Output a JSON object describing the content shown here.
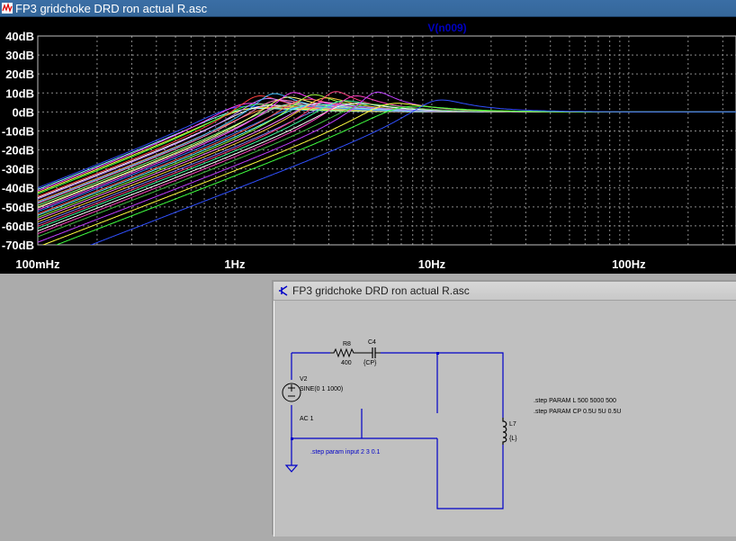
{
  "plot_window": {
    "title": "FP3 gridchoke DRD ron actual R.asc",
    "trace_label": "V(n009)",
    "colors": {
      "background": "#000000",
      "grid": "#8a8a8a",
      "axis_text": "#ffffff",
      "trace_label": "#0000c0"
    }
  },
  "chart_data": {
    "type": "line",
    "title": "",
    "xscale": "log",
    "xlim_hz": [
      0.1,
      350
    ],
    "ylim_db": [
      -70,
      40
    ],
    "grid": true,
    "x_tick_labels": [
      "100mHz",
      "1Hz",
      "10Hz",
      "100Hz"
    ],
    "y_tick_labels": [
      "40dB",
      "30dB",
      "20dB",
      "10dB",
      "0dB",
      "-10dB",
      "-20dB",
      "-30dB",
      "-40dB",
      "-50dB",
      "-60dB",
      "-70dB"
    ],
    "y_ticks_db": [
      40,
      30,
      20,
      10,
      0,
      -10,
      -20,
      -30,
      -40,
      -50,
      -60,
      -70
    ],
    "x_ticks_hz": [
      0.1,
      1,
      10,
      100
    ],
    "series_description_values": {
      "resonance_hz_range": [
        1,
        10.5
      ],
      "peak_db_range": [
        12,
        32
      ],
      "lowfreq_db_at_100mHz_range": [
        -66,
        -40
      ]
    },
    "series": [
      {
        "color": "#3050ff",
        "f0": 1.0,
        "q": 1.3
      },
      {
        "color": "#80ffff",
        "f0": 1.05,
        "q": 1.1
      },
      {
        "color": "#ff40ff",
        "f0": 1.1,
        "q": 1.6
      },
      {
        "color": "#ffff40",
        "f0": 1.15,
        "q": 1.2
      },
      {
        "color": "#40ff40",
        "f0": 1.2,
        "q": 1.5
      },
      {
        "color": "#ff4040",
        "f0": 1.3,
        "q": 2.6
      },
      {
        "color": "#ffffff",
        "f0": 1.35,
        "q": 1.4
      },
      {
        "color": "#c080ff",
        "f0": 1.4,
        "q": 2.2
      },
      {
        "color": "#ff8040",
        "f0": 1.5,
        "q": 1.3
      },
      {
        "color": "#40c0ff",
        "f0": 1.55,
        "q": 3.0
      },
      {
        "color": "#ff80c0",
        "f0": 1.6,
        "q": 2.0
      },
      {
        "color": "#80ff80",
        "f0": 1.7,
        "q": 1.4
      },
      {
        "color": "#ffff80",
        "f0": 1.8,
        "q": 2.4
      },
      {
        "color": "#c0c0c0",
        "f0": 1.85,
        "q": 1.6
      },
      {
        "color": "#ff40ff",
        "f0": 1.95,
        "q": 3.2
      },
      {
        "color": "#4080ff",
        "f0": 2.05,
        "q": 1.3
      },
      {
        "color": "#ff6060",
        "f0": 2.2,
        "q": 2.1
      },
      {
        "color": "#60ffff",
        "f0": 2.3,
        "q": 1.5
      },
      {
        "color": "#a0ff40",
        "f0": 2.45,
        "q": 2.8
      },
      {
        "color": "#ff80ff",
        "f0": 2.6,
        "q": 1.7
      },
      {
        "color": "#ffd040",
        "f0": 2.8,
        "q": 2.3
      },
      {
        "color": "#8080ff",
        "f0": 3.0,
        "q": 1.4
      },
      {
        "color": "#ff4080",
        "f0": 3.2,
        "q": 3.4
      },
      {
        "color": "#40ffa0",
        "f0": 3.4,
        "q": 1.9
      },
      {
        "color": "#ffffff",
        "f0": 3.7,
        "q": 1.6
      },
      {
        "color": "#ff40c0",
        "f0": 4.0,
        "q": 2.6
      },
      {
        "color": "#40c040",
        "f0": 4.4,
        "q": 1.5
      },
      {
        "color": "#c040ff",
        "f0": 5.2,
        "q": 3.3
      },
      {
        "color": "#ffff40",
        "f0": 6.0,
        "q": 1.6
      },
      {
        "color": "#40ff40",
        "f0": 7.0,
        "q": 1.3
      },
      {
        "color": "#3050ff",
        "f0": 10.5,
        "q": 2.0
      }
    ]
  },
  "schematic_window": {
    "title": "FP3 gridchoke DRD ron actual R.asc",
    "labels": {
      "r8_name": "R8",
      "r8_value": "400",
      "c4_name": "C4",
      "c4_value": "{CP}",
      "v2_name": "V2",
      "v2_value": "SINE(0 1 1000)",
      "v2_ac": "AC 1",
      "l7_name": "L7",
      "l7_value": "{L}",
      "step_input": ".step param input 2 3 0.1",
      "step_L": ".step PARAM L 500 5000 500",
      "step_CP": ".step PARAM CP 0.5U 5U 0.5U"
    },
    "colors": {
      "wire": "#0000c8",
      "component": "#000000",
      "text": "#000000",
      "directive": "#0000c8"
    }
  }
}
